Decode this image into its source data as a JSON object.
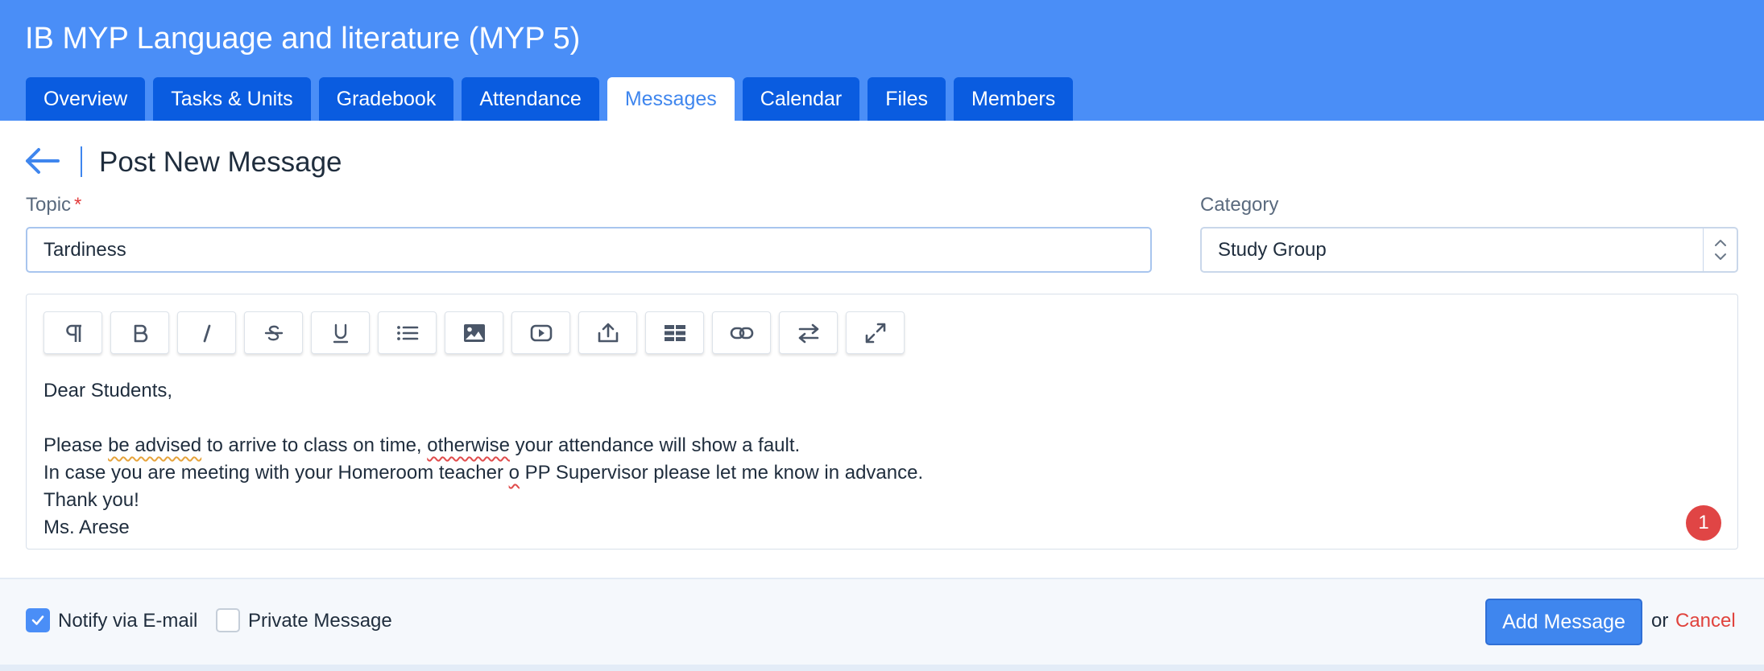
{
  "course": {
    "title": "IB MYP Language and literature (MYP 5)"
  },
  "tabs": [
    {
      "label": "Overview"
    },
    {
      "label": "Tasks & Units"
    },
    {
      "label": "Gradebook"
    },
    {
      "label": "Attendance"
    },
    {
      "label": "Messages",
      "active": true
    },
    {
      "label": "Calendar"
    },
    {
      "label": "Files"
    },
    {
      "label": "Members"
    }
  ],
  "page": {
    "title": "Post New Message"
  },
  "form": {
    "topic": {
      "label": "Topic",
      "required_mark": "*",
      "value": "Tardiness"
    },
    "category": {
      "label": "Category",
      "value": "Study Group"
    }
  },
  "editor": {
    "toolbar": [
      "paragraph-icon",
      "bold-icon",
      "italic-icon",
      "strikethrough-icon",
      "underline-icon",
      "list-icon",
      "image-icon",
      "video-icon",
      "upload-icon",
      "table-icon",
      "link-icon",
      "swap-icon",
      "fullscreen-icon"
    ],
    "body": {
      "greeting": "Dear Students,",
      "l2_a": "Please ",
      "l2_b": "be advised",
      "l2_c": " to arrive to class on time, ",
      "l2_d": "otherwise",
      "l2_e": " your attendance will show a fault.",
      "l3_a": "In case you are meeting with your Homeroom teacher ",
      "l3_b": "o",
      "l3_c": " PP Supervisor please let me know in advance.",
      "l4": "Thank you!",
      "l5": "Ms. Arese"
    },
    "issue_count": "1"
  },
  "options": {
    "notify": {
      "label": "Notify via E-mail",
      "checked": true
    },
    "private": {
      "label": "Private Message",
      "checked": false
    }
  },
  "actions": {
    "submit_label": "Add Message",
    "or_text": "or",
    "cancel_label": "Cancel"
  },
  "colors": {
    "header_bg": "#4a8ef7",
    "tab_bg": "#0a5ce0",
    "accent": "#3f86ee",
    "danger": "#e0433d"
  }
}
